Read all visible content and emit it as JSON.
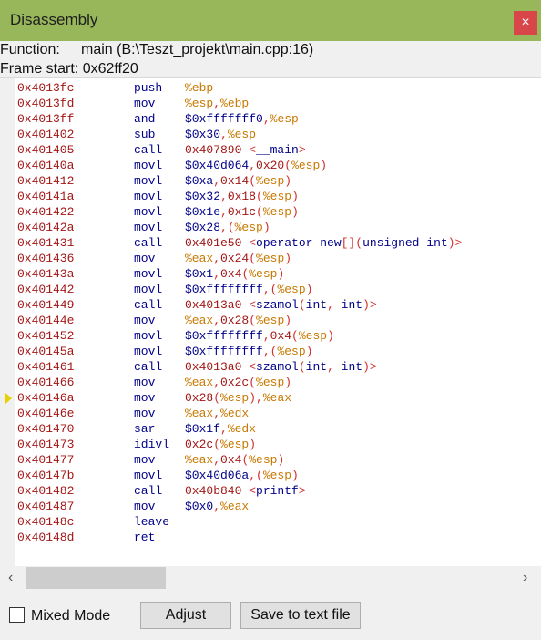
{
  "window": {
    "title": "Disassembly",
    "close_label": "×"
  },
  "info": {
    "function_label": "Function:",
    "function_value": "main (B:\\Teszt_projekt\\main.cpp:16)",
    "frame_label": "Frame start:",
    "frame_value": "0x62ff20"
  },
  "current_line_index": 20,
  "lines": [
    {
      "addr": "0x4013fc",
      "mn": "push",
      "ops": [
        [
          "%ebp",
          "reg"
        ]
      ]
    },
    {
      "addr": "0x4013fd",
      "mn": "mov",
      "ops": [
        [
          "%esp",
          "reg"
        ],
        [
          ",",
          "p"
        ],
        [
          "%ebp",
          "reg"
        ]
      ]
    },
    {
      "addr": "0x4013ff",
      "mn": "and",
      "ops": [
        [
          "$0xfffffff0",
          "imm"
        ],
        [
          ",",
          "p"
        ],
        [
          "%esp",
          "reg"
        ]
      ]
    },
    {
      "addr": "0x401402",
      "mn": "sub",
      "ops": [
        [
          "$0x30",
          "imm"
        ],
        [
          ",",
          "p"
        ],
        [
          "%esp",
          "reg"
        ]
      ]
    },
    {
      "addr": "0x401405",
      "mn": "call",
      "ops": [
        [
          "0x407890",
          "num"
        ],
        [
          " <",
          "p"
        ],
        [
          "__main",
          "sym"
        ],
        [
          ">",
          "p"
        ]
      ]
    },
    {
      "addr": "0x40140a",
      "mn": "movl",
      "ops": [
        [
          "$0x40d064",
          "imm"
        ],
        [
          ",",
          "p"
        ],
        [
          "0x20",
          "num"
        ],
        [
          "(",
          "p"
        ],
        [
          "%esp",
          "reg"
        ],
        [
          ")",
          "p"
        ]
      ]
    },
    {
      "addr": "0x401412",
      "mn": "movl",
      "ops": [
        [
          "$0xa",
          "imm"
        ],
        [
          ",",
          "p"
        ],
        [
          "0x14",
          "num"
        ],
        [
          "(",
          "p"
        ],
        [
          "%esp",
          "reg"
        ],
        [
          ")",
          "p"
        ]
      ]
    },
    {
      "addr": "0x40141a",
      "mn": "movl",
      "ops": [
        [
          "$0x32",
          "imm"
        ],
        [
          ",",
          "p"
        ],
        [
          "0x18",
          "num"
        ],
        [
          "(",
          "p"
        ],
        [
          "%esp",
          "reg"
        ],
        [
          ")",
          "p"
        ]
      ]
    },
    {
      "addr": "0x401422",
      "mn": "movl",
      "ops": [
        [
          "$0x1e",
          "imm"
        ],
        [
          ",",
          "p"
        ],
        [
          "0x1c",
          "num"
        ],
        [
          "(",
          "p"
        ],
        [
          "%esp",
          "reg"
        ],
        [
          ")",
          "p"
        ]
      ]
    },
    {
      "addr": "0x40142a",
      "mn": "movl",
      "ops": [
        [
          "$0x28",
          "imm"
        ],
        [
          ",(",
          "p"
        ],
        [
          "%esp",
          "reg"
        ],
        [
          ")",
          "p"
        ]
      ]
    },
    {
      "addr": "0x401431",
      "mn": "call",
      "ops": [
        [
          "0x401e50",
          "num"
        ],
        [
          " <",
          "p"
        ],
        [
          "operator new",
          "sym"
        ],
        [
          "[](",
          "p"
        ],
        [
          "unsigned int",
          "sym"
        ],
        [
          ")>",
          "p"
        ]
      ]
    },
    {
      "addr": "0x401436",
      "mn": "mov",
      "ops": [
        [
          "%eax",
          "reg"
        ],
        [
          ",",
          "p"
        ],
        [
          "0x24",
          "num"
        ],
        [
          "(",
          "p"
        ],
        [
          "%esp",
          "reg"
        ],
        [
          ")",
          "p"
        ]
      ]
    },
    {
      "addr": "0x40143a",
      "mn": "movl",
      "ops": [
        [
          "$0x1",
          "imm"
        ],
        [
          ",",
          "p"
        ],
        [
          "0x4",
          "num"
        ],
        [
          "(",
          "p"
        ],
        [
          "%esp",
          "reg"
        ],
        [
          ")",
          "p"
        ]
      ]
    },
    {
      "addr": "0x401442",
      "mn": "movl",
      "ops": [
        [
          "$0xffffffff",
          "imm"
        ],
        [
          ",(",
          "p"
        ],
        [
          "%esp",
          "reg"
        ],
        [
          ")",
          "p"
        ]
      ]
    },
    {
      "addr": "0x401449",
      "mn": "call",
      "ops": [
        [
          "0x4013a0",
          "num"
        ],
        [
          " <",
          "p"
        ],
        [
          "szamol",
          "sym"
        ],
        [
          "(",
          "p"
        ],
        [
          "int",
          "sym"
        ],
        [
          ", ",
          "p"
        ],
        [
          "int",
          "sym"
        ],
        [
          ")>",
          "p"
        ]
      ]
    },
    {
      "addr": "0x40144e",
      "mn": "mov",
      "ops": [
        [
          "%eax",
          "reg"
        ],
        [
          ",",
          "p"
        ],
        [
          "0x28",
          "num"
        ],
        [
          "(",
          "p"
        ],
        [
          "%esp",
          "reg"
        ],
        [
          ")",
          "p"
        ]
      ]
    },
    {
      "addr": "0x401452",
      "mn": "movl",
      "ops": [
        [
          "$0xffffffff",
          "imm"
        ],
        [
          ",",
          "p"
        ],
        [
          "0x4",
          "num"
        ],
        [
          "(",
          "p"
        ],
        [
          "%esp",
          "reg"
        ],
        [
          ")",
          "p"
        ]
      ]
    },
    {
      "addr": "0x40145a",
      "mn": "movl",
      "ops": [
        [
          "$0xffffffff",
          "imm"
        ],
        [
          ",(",
          "p"
        ],
        [
          "%esp",
          "reg"
        ],
        [
          ")",
          "p"
        ]
      ]
    },
    {
      "addr": "0x401461",
      "mn": "call",
      "ops": [
        [
          "0x4013a0",
          "num"
        ],
        [
          " <",
          "p"
        ],
        [
          "szamol",
          "sym"
        ],
        [
          "(",
          "p"
        ],
        [
          "int",
          "sym"
        ],
        [
          ", ",
          "p"
        ],
        [
          "int",
          "sym"
        ],
        [
          ")>",
          "p"
        ]
      ]
    },
    {
      "addr": "0x401466",
      "mn": "mov",
      "ops": [
        [
          "%eax",
          "reg"
        ],
        [
          ",",
          "p"
        ],
        [
          "0x2c",
          "num"
        ],
        [
          "(",
          "p"
        ],
        [
          "%esp",
          "reg"
        ],
        [
          ")",
          "p"
        ]
      ]
    },
    {
      "addr": "0x40146a",
      "mn": "mov",
      "ops": [
        [
          "0x28",
          "num"
        ],
        [
          "(",
          "p"
        ],
        [
          "%esp",
          "reg"
        ],
        [
          "),",
          "p"
        ],
        [
          "%eax",
          "reg"
        ]
      ]
    },
    {
      "addr": "0x40146e",
      "mn": "mov",
      "ops": [
        [
          "%eax",
          "reg"
        ],
        [
          ",",
          "p"
        ],
        [
          "%edx",
          "reg"
        ]
      ]
    },
    {
      "addr": "0x401470",
      "mn": "sar",
      "ops": [
        [
          "$0x1f",
          "imm"
        ],
        [
          ",",
          "p"
        ],
        [
          "%edx",
          "reg"
        ]
      ]
    },
    {
      "addr": "0x401473",
      "mn": "idivl",
      "ops": [
        [
          "0x2c",
          "num"
        ],
        [
          "(",
          "p"
        ],
        [
          "%esp",
          "reg"
        ],
        [
          ")",
          "p"
        ]
      ]
    },
    {
      "addr": "0x401477",
      "mn": "mov",
      "ops": [
        [
          "%eax",
          "reg"
        ],
        [
          ",",
          "p"
        ],
        [
          "0x4",
          "num"
        ],
        [
          "(",
          "p"
        ],
        [
          "%esp",
          "reg"
        ],
        [
          ")",
          "p"
        ]
      ]
    },
    {
      "addr": "0x40147b",
      "mn": "movl",
      "ops": [
        [
          "$0x40d06a",
          "imm"
        ],
        [
          ",(",
          "p"
        ],
        [
          "%esp",
          "reg"
        ],
        [
          ")",
          "p"
        ]
      ]
    },
    {
      "addr": "0x401482",
      "mn": "call",
      "ops": [
        [
          "0x40b840",
          "num"
        ],
        [
          " <",
          "p"
        ],
        [
          "printf",
          "sym"
        ],
        [
          ">",
          "p"
        ]
      ]
    },
    {
      "addr": "0x401487",
      "mn": "mov",
      "ops": [
        [
          "$0x0",
          "imm"
        ],
        [
          ",",
          "p"
        ],
        [
          "%eax",
          "reg"
        ]
      ]
    },
    {
      "addr": "0x40148c",
      "mn": "leave",
      "ops": []
    },
    {
      "addr": "0x40148d",
      "mn": "ret",
      "ops": []
    }
  ],
  "scrollbar": {
    "left_icon": "chevron-left-icon",
    "right_icon": "chevron-right-icon",
    "left_glyph": "‹",
    "right_glyph": "›"
  },
  "footer": {
    "mixed_mode_label": "Mixed Mode",
    "mixed_mode_checked": false,
    "adjust_label": "Adjust",
    "save_label": "Save to text file"
  }
}
